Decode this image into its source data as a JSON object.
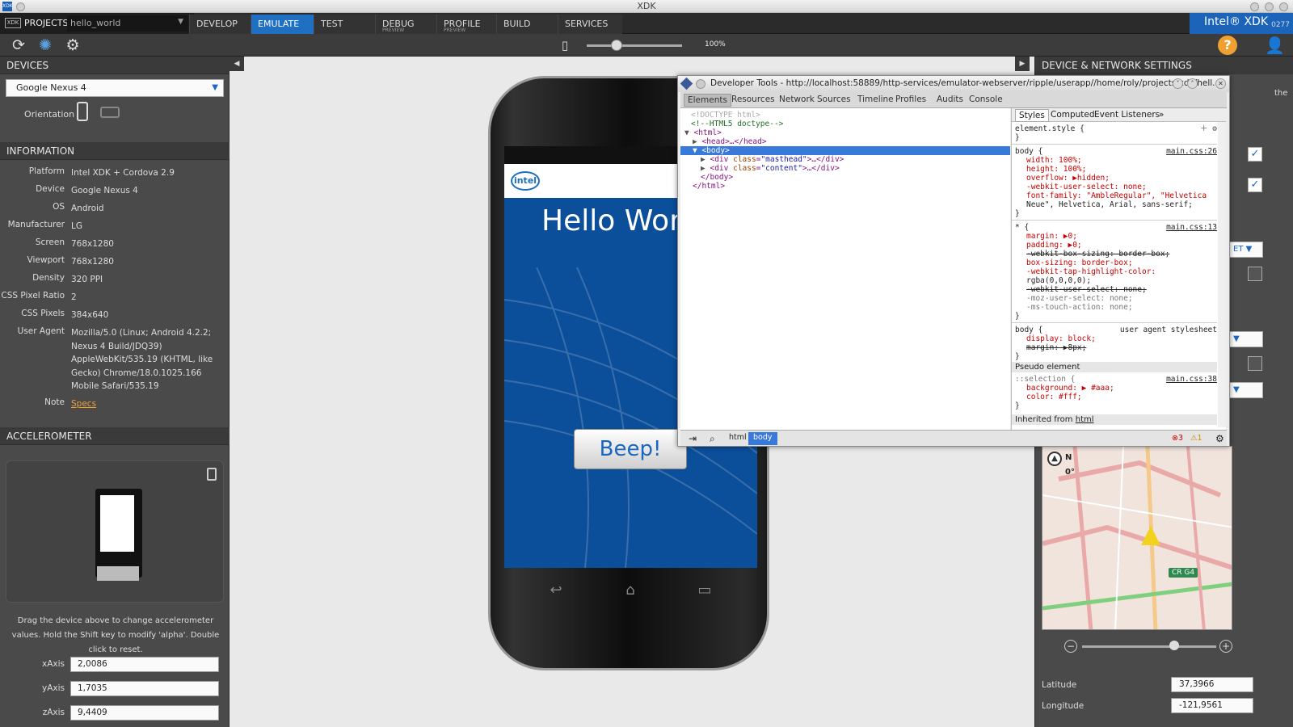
{
  "window": {
    "title": "XDK"
  },
  "nav": {
    "projects_label": "PROJECTS",
    "project_name": "hello_world",
    "tabs": [
      {
        "label": "DEVELOP",
        "sub": ""
      },
      {
        "label": "EMULATE",
        "sub": ""
      },
      {
        "label": "TEST",
        "sub": ""
      },
      {
        "label": "DEBUG",
        "sub": "PREVIEW"
      },
      {
        "label": "PROFILE",
        "sub": "PREVIEW"
      },
      {
        "label": "BUILD",
        "sub": ""
      },
      {
        "label": "SERVICES",
        "sub": ""
      }
    ],
    "active_tab": "EMULATE",
    "brand": "Intel® XDK",
    "version": "0277"
  },
  "toolbar": {
    "icons": [
      "refresh-icon",
      "debug-icon",
      "settings-icon",
      "rotate-device-icon",
      "help-icon",
      "user-icon"
    ],
    "zoom_level": "100%"
  },
  "devices": {
    "header": "DEVICES",
    "selected_device": "Google Nexus 4",
    "orientation_label": "Orientation"
  },
  "information": {
    "header": "INFORMATION",
    "rows": [
      {
        "key": "Platform",
        "value": "Intel XDK + Cordova 2.9"
      },
      {
        "key": "Device",
        "value": "Google Nexus 4"
      },
      {
        "key": "OS",
        "value": "Android"
      },
      {
        "key": "Manufacturer",
        "value": "LG"
      },
      {
        "key": "Screen",
        "value": "768x1280"
      },
      {
        "key": "Viewport",
        "value": "768x1280"
      },
      {
        "key": "Density",
        "value": "320 PPI"
      },
      {
        "key": "CSS Pixel Ratio",
        "value": "2"
      },
      {
        "key": "CSS Pixels",
        "value": "384x640"
      },
      {
        "key": "User Agent",
        "value": "Mozilla/5.0 (Linux; Android 4.2.2; Nexus 4 Build/JDQ39) AppleWebKit/535.19 (KHTML, like Gecko) Chrome/18.0.1025.166 Mobile Safari/535.19"
      },
      {
        "key": "Note",
        "value": "Specs"
      }
    ]
  },
  "accelerometer": {
    "header": "ACCELEROMETER",
    "hint": "Drag the device above to change accelerometer values. Hold the Shift key to modify 'alpha'. Double click to reset.",
    "axes": [
      {
        "label": "xAxis",
        "value": "2,0086"
      },
      {
        "label": "yAxis",
        "value": "1,7035"
      },
      {
        "label": "zAxis",
        "value": "9,4409"
      }
    ]
  },
  "emulator": {
    "app_title": "Hello World",
    "logo_text": "intel",
    "beep_label": "Beep!"
  },
  "right_panel": {
    "header": "DEVICE & NETWORK SETTINGS",
    "partial_text": "the",
    "select_value": "ET",
    "map": {
      "north_label": "N",
      "heading": "0°",
      "road_label": "CR G4"
    },
    "latitude_label": "Latitude",
    "latitude_value": "37,3966",
    "longitude_label": "Longitude",
    "longitude_value": "-121,9561"
  },
  "devtools": {
    "title": "Developer Tools - http://localhost:58889/http-services/emulator-webserver/ripple/userapp//home/roly/projects/xdk/hell...",
    "tabs": [
      "Elements",
      "Resources",
      "Network",
      "Sources",
      "Timeline",
      "Profiles",
      "Audits",
      "Console"
    ],
    "active_tab": "Elements",
    "dom": {
      "doctype": "<!DOCTYPE html>",
      "comment": "<!--HTML5 doctype-->",
      "html_open": "<html>",
      "head": "<head>…</head>",
      "body_open": "<body>",
      "div1_tag": "div",
      "div1_attr": "class",
      "div1_val": "\"masthead\"",
      "div1_rest": ">…</div>",
      "div2_tag": "div",
      "div2_attr": "class",
      "div2_val": "\"content\"",
      "div2_rest": ">…</div>",
      "body_close": "</body>",
      "html_close": "</html>"
    },
    "styles": {
      "tabs": [
        "Styles",
        "Computed",
        "Event Listeners"
      ],
      "more": "»",
      "element_style": "element.style {",
      "rules": [
        {
          "selector": "body {",
          "source": "main.css:26",
          "props": [
            {
              "text": "width: 100%;"
            },
            {
              "text": "height: 100%;"
            },
            {
              "text": "overflow: ▶hidden;"
            },
            {
              "text": "-webkit-user-select: none;"
            },
            {
              "text": "font-family: \"AmbleRegular\", \"Helvetica"
            },
            {
              "text": "  Neue\", Helvetica, Arial, sans-serif;"
            }
          ]
        },
        {
          "selector": "* {",
          "source": "main.css:13",
          "props": [
            {
              "text": "margin: ▶0;"
            },
            {
              "text": "padding: ▶0;"
            },
            {
              "text": "-webkit-box-sizing: border-box;"
            },
            {
              "text": "box-sizing: border-box;"
            },
            {
              "text": "-webkit-tap-highlight-color:"
            },
            {
              "text": "  rgba(0,0,0,0);"
            },
            {
              "text": "-webkit-user-select: none;"
            },
            {
              "text": "-moz-user-select: none;"
            },
            {
              "text": "-ms-touch-action: none;"
            }
          ]
        },
        {
          "selector": "body {",
          "source": "user agent stylesheet",
          "props": [
            {
              "text": "display: block;"
            },
            {
              "text": "margin: ▶8px;"
            }
          ]
        }
      ],
      "pseudo_header": "Pseudo element",
      "selection_selector": "::selection {",
      "selection_source": "main.css:38",
      "selection_props": [
        {
          "text": "background: ▶ #aaa;"
        },
        {
          "text": "color: #fff;"
        }
      ],
      "inherited_label": "Inherited from",
      "inherited_link": "html"
    },
    "breadcrumbs": [
      "html",
      "body"
    ],
    "errors": "3",
    "warnings": "1"
  }
}
